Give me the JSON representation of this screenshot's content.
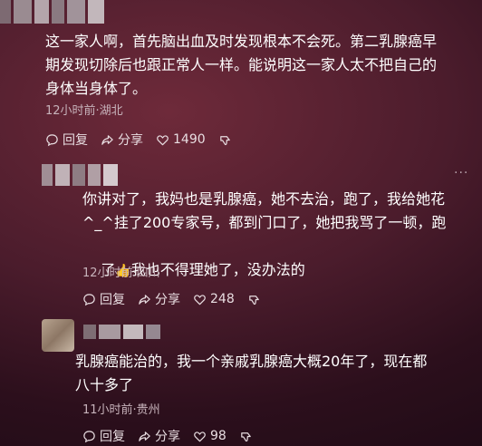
{
  "comments": [
    {
      "text": "这一家人啊，首先脑出血及时发现根本不会死。第二乳腺癌早\n期发现切除后也跟正常人一样。能说明这一家人太不把自己的\n身体当身体了。",
      "time_location": "12小时前·湖北",
      "reply_label": "回复",
      "share_label": "分享",
      "likes": "1490"
    },
    {
      "text_line1": "你讲对了，我妈也是乳腺癌，她不去治，跑了，我给她花",
      "text_line2": "^_^挂了200专家号，都到门口了，她把我骂了一顿，跑",
      "text_line3_pre": "了",
      "text_line3_post": "我也不得理她了，没办法的",
      "time_location": "12小时前·四川",
      "reply_label": "回复",
      "share_label": "分享",
      "likes": "248",
      "more_label": "···"
    },
    {
      "text": "乳腺癌能治的，我一个亲戚乳腺癌大概20年了，现在都\n八十多了",
      "time_location": "11小时前·贵州",
      "reply_label": "回复",
      "share_label": "分享",
      "likes": "98"
    }
  ],
  "icons": {
    "reply": "comment-bubble-icon",
    "share": "share-arrow-icon",
    "like": "heart-icon",
    "dislike": "thumb-down-icon",
    "emoji": "thumbs-up-emoji"
  }
}
